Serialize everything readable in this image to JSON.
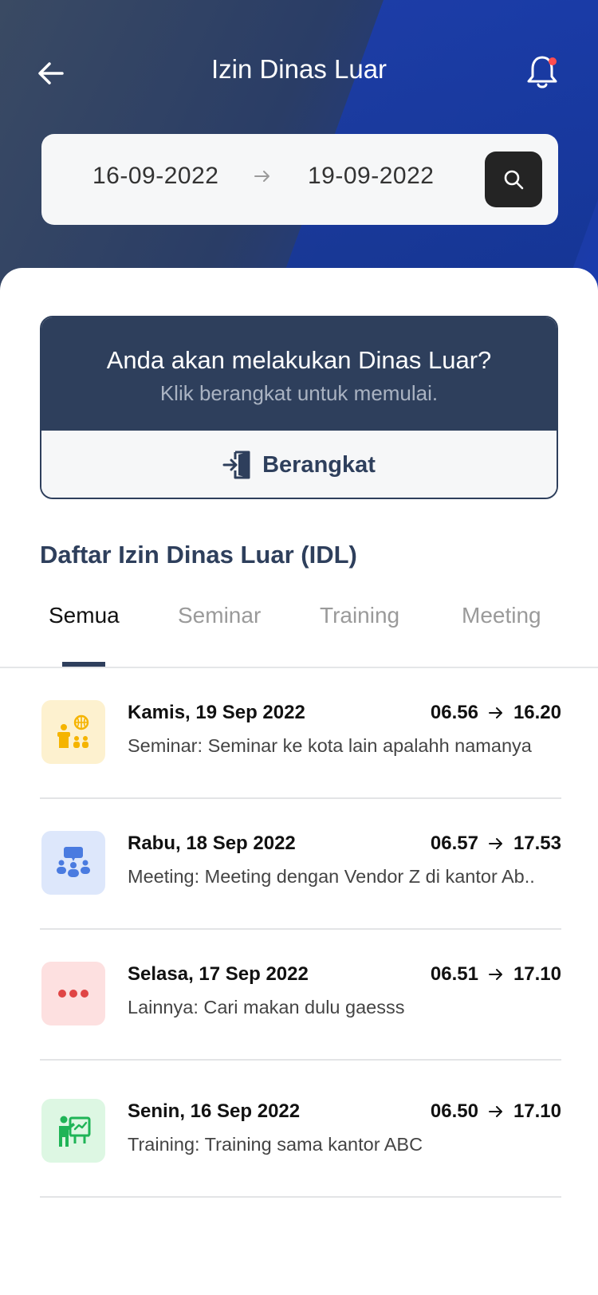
{
  "header": {
    "title": "Izin Dinas Luar",
    "date_from": "16-09-2022",
    "date_to": "19-09-2022"
  },
  "prompt": {
    "title": "Anda akan melakukan Dinas Luar?",
    "subtitle": "Klik berangkat untuk memulai.",
    "button_label": "Berangkat"
  },
  "section_title": "Daftar Izin Dinas Luar (IDL)",
  "tabs": [
    {
      "label": "Semua",
      "active": true
    },
    {
      "label": "Seminar",
      "active": false
    },
    {
      "label": "Training",
      "active": false
    },
    {
      "label": "Meeting",
      "active": false
    }
  ],
  "items": [
    {
      "date": "Kamis, 19 Sep 2022",
      "start": "06.56",
      "end": "16.20",
      "desc": "Seminar: Seminar ke kota lain apalahh namanya",
      "icon": "seminar-icon",
      "icon_bg": "#fdf1cf",
      "icon_color": "#f5b400"
    },
    {
      "date": "Rabu, 18 Sep 2022",
      "start": "06.57",
      "end": "17.53",
      "desc": "Meeting: Meeting dengan Vendor Z di kantor Ab..",
      "icon": "meeting-icon",
      "icon_bg": "#dde7fb",
      "icon_color": "#4a7be0"
    },
    {
      "date": "Selasa, 17 Sep 2022",
      "start": "06.51",
      "end": "17.10",
      "desc": "Lainnya: Cari makan dulu gaesss",
      "icon": "more-icon",
      "icon_bg": "#fde0e0",
      "icon_color": "#e04545"
    },
    {
      "date": "Senin, 16 Sep 2022",
      "start": "06.50",
      "end": "17.10",
      "desc": "Training: Training sama kantor ABC",
      "icon": "training-icon",
      "icon_bg": "#ddf7e3",
      "icon_color": "#1fb457"
    }
  ],
  "colors": {
    "primary": "#2e3f5c",
    "notification_dot": "#ff4d4f"
  }
}
